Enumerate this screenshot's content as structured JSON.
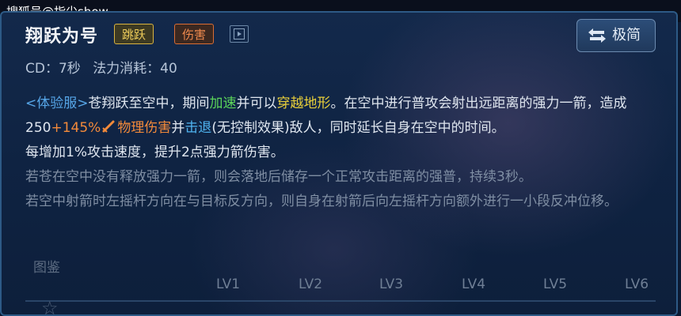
{
  "watermark": "搜狐号@指尖show",
  "skill": {
    "name": "翔跃为号",
    "tags": [
      "跳跃",
      "伤害"
    ],
    "cd": "CD：7秒",
    "cost": "法力消耗：40"
  },
  "compare_button": "极简",
  "description": {
    "seg1_prefix": "<体验服>",
    "seg1_a": "苍翔跃至空中，期间",
    "seg1_speed": "加速",
    "seg1_b": "并可以",
    "seg1_terrain": "穿越地形",
    "seg1_c": "。在空中进行普攻会射出远距离的强力一箭，造成250",
    "seg1_scale": "+145%",
    "seg1_dmg": "物理伤害",
    "seg1_d": "并",
    "seg1_knock": "击退",
    "seg1_e": "(无控制效果)敌人，同时延长自身在空中的时间。",
    "line2": "每增加1%攻击速度，提升2点强力箭伤害。",
    "line3": "若苍在空中没有释放强力一箭，则会落地后储存一个正常攻击距离的强普，持续3秒。",
    "line4": "若空中射箭时左摇杆方向在与目标反方向，则自身在射箭后向左摇杆方向额外进行一小段反冲位移。"
  },
  "gallery_label": "图鉴",
  "levels": [
    "LV1",
    "LV2",
    "LV3",
    "LV4",
    "LV5",
    "LV6"
  ],
  "colors": {
    "link": "#56a6e8",
    "green": "#5bd45a",
    "yellow": "#e8cf3a",
    "orange": "#f38a3a",
    "blue": "#4fb4f0"
  }
}
